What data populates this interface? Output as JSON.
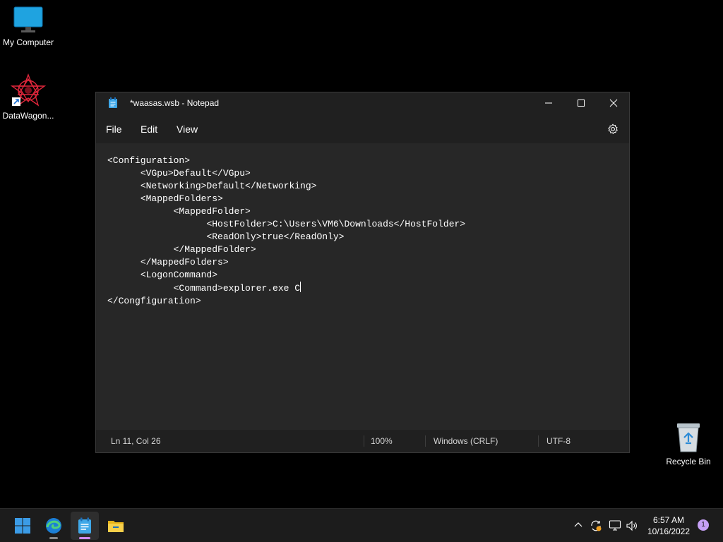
{
  "desktop": {
    "icons": [
      {
        "label": "My Computer"
      },
      {
        "label": "DataWagon..."
      },
      {
        "label": "Recycle Bin"
      }
    ]
  },
  "window": {
    "title": "*waasas.wsb - Notepad",
    "menu": {
      "file": "File",
      "edit": "Edit",
      "view": "View"
    },
    "editor_text": "<Configuration>\n\t<VGpu>Default</VGpu>\n\t<Networking>Default</Networking>\n\t<MappedFolders>\n\t\t<MappedFolder>\n\t\t\t<HostFolder>C:\\Users\\VM6\\Downloads</HostFolder>\n\t\t\t<ReadOnly>true</ReadOnly>\n\t\t</MappedFolder>\n\t</MappedFolders>\n\t<LogonCommand>\n\t\t<Command>explorer.exe C",
    "editor_text_tail": "\n</Congfiguration>",
    "status": {
      "position": "Ln 11, Col 26",
      "zoom": "100%",
      "line_ending": "Windows (CRLF)",
      "encoding": "UTF-8"
    }
  },
  "taskbar": {
    "apps": [
      "start-icon",
      "edge-icon",
      "notepad-icon",
      "file-explorer-icon"
    ],
    "clock": {
      "time": "6:57 AM",
      "date": "10/16/2022"
    },
    "notification_count": "1"
  }
}
